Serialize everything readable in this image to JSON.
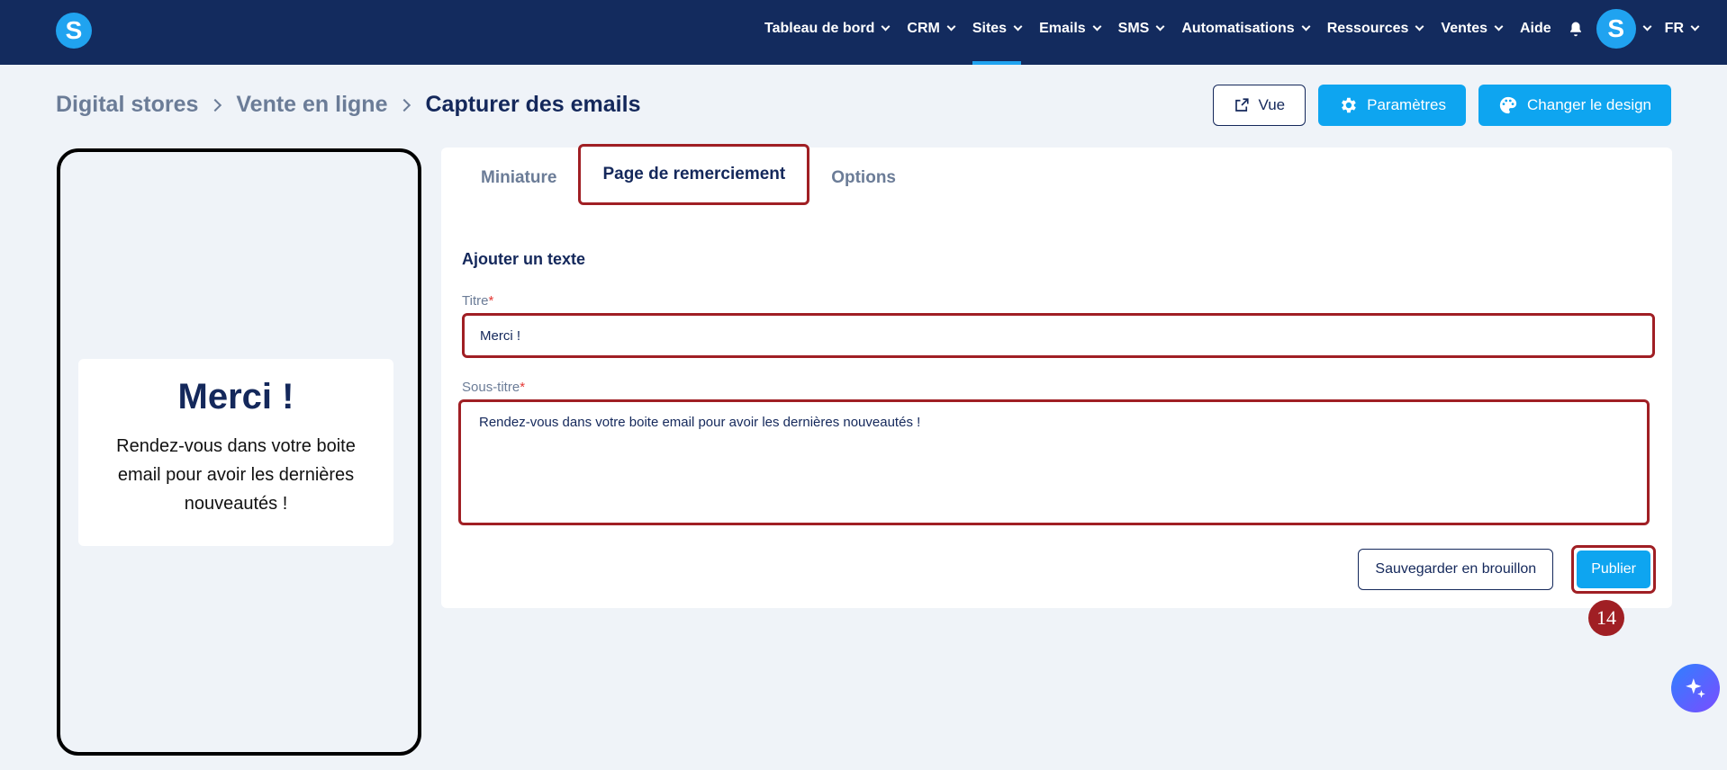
{
  "nav": {
    "items": [
      {
        "label": "Tableau de bord"
      },
      {
        "label": "CRM"
      },
      {
        "label": "Sites"
      },
      {
        "label": "Emails"
      },
      {
        "label": "SMS"
      },
      {
        "label": "Automatisations"
      },
      {
        "label": "Ressources"
      },
      {
        "label": "Ventes"
      },
      {
        "label": "Aide"
      }
    ],
    "logo_letter": "S",
    "avatar_letter": "S",
    "language": "FR"
  },
  "breadcrumb": [
    "Digital stores",
    "Vente en ligne",
    "Capturer des emails"
  ],
  "header_buttons": {
    "view": "Vue",
    "settings": "Paramètres",
    "design": "Changer le design"
  },
  "preview": {
    "title": "Merci !",
    "subtitle": "Rendez-vous dans votre boite email pour avoir les dernières nouveautés !"
  },
  "tabs": [
    "Miniature",
    "Page de remerciement",
    "Options"
  ],
  "form": {
    "section_title": "Ajouter un texte",
    "title_label": "Titre",
    "title_value": "Merci !",
    "subtitle_label": "Sous-titre",
    "subtitle_value": "Rendez-vous dans votre boite email pour avoir les dernières nouveautés !",
    "required_mark": "*",
    "draft_button": "Sauvegarder en brouillon",
    "publish_button": "Publier"
  },
  "step_badge": "14",
  "colors": {
    "navy": "#132b5e",
    "accent": "#0ea5f0",
    "highlight": "#a01f24"
  }
}
